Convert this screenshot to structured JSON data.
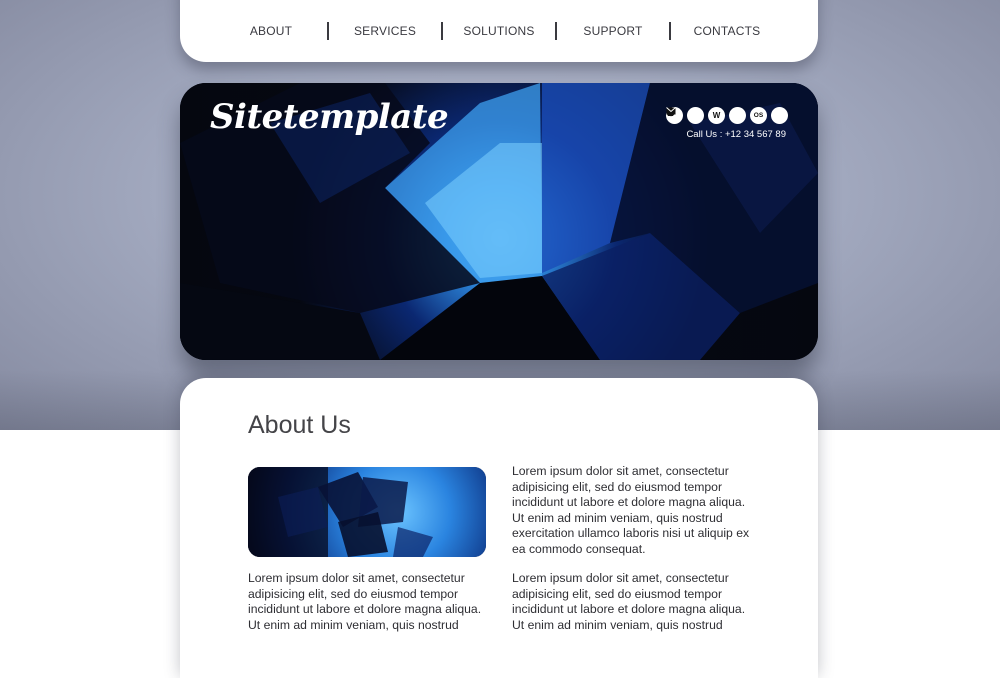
{
  "nav": {
    "items": [
      "ABOUT",
      "SERVICES",
      "SOLUTIONS",
      "SUPPORT",
      "CONTACTS"
    ]
  },
  "header": {
    "logo": "Sitetemplate",
    "social_icons": [
      "drop-icon",
      "star-icon",
      "w-icon",
      "compass-icon",
      "os-icon",
      "mail-icon"
    ],
    "social_labels": [
      "",
      "",
      "W",
      "",
      "OS",
      ""
    ],
    "phone": "Call Us : +12 34 567 89"
  },
  "main": {
    "title": "About Us",
    "paragraph_1": "Lorem ipsum dolor sit amet, consectetur adipisicing elit, sed do eiusmod tempor incididunt ut labore et dolore magna aliqua. Ut enim ad minim veniam, quis nostrud exercitation ullamco laboris nisi ut aliquip ex ea commodo consequat.",
    "paragraph_2": "Lorem ipsum dolor sit amet, consectetur adipisicing elit, sed do eiusmod tempor incididunt ut labore et dolore magna aliqua. Ut enim ad minim veniam, quis nostrud",
    "paragraph_3": "Lorem ipsum dolor sit amet, consectetur adipisicing elit, sed do eiusmod tempor incididunt ut labore et dolore magna aliqua. Ut enim ad minim veniam, quis nostrud"
  },
  "colors": {
    "banner_dark": "#05070f",
    "banner_blue": "#2f8fe8",
    "page_bg": "#a3aac0"
  }
}
